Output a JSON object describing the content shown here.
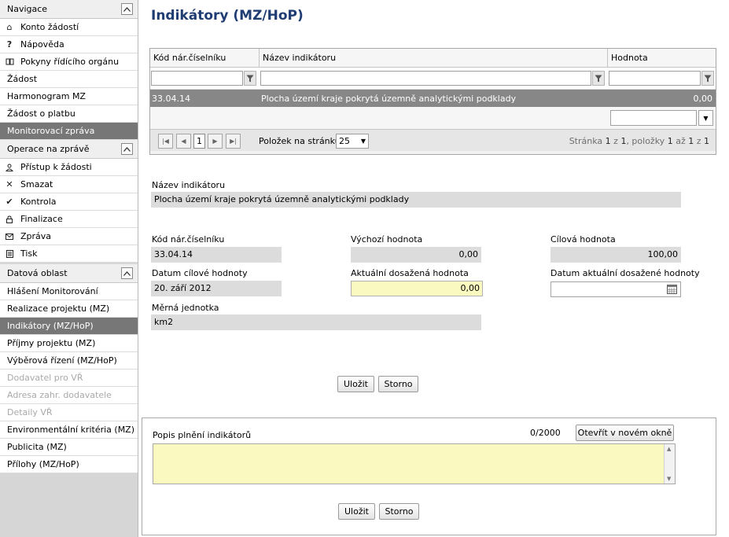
{
  "sidebar": {
    "nav_header": "Navigace",
    "nav_items": [
      {
        "label": "Konto žádostí",
        "icon": "home-icon"
      },
      {
        "label": "Nápověda",
        "icon": "question-icon"
      },
      {
        "label": "Pokyny řídícího orgánu",
        "icon": "book-icon"
      }
    ],
    "plain_items": [
      "Žádost",
      "Harmonogram MZ",
      "Žádost o platbu"
    ],
    "monitor_active": "Monitorovací zpráva",
    "ops_header": "Operace na zprávě",
    "ops_items": [
      {
        "label": "Přístup k žádosti",
        "icon": "user-icon"
      },
      {
        "label": "Smazat",
        "icon": "delete-icon"
      },
      {
        "label": "Kontrola",
        "icon": "check-icon"
      },
      {
        "label": "Finalizace",
        "icon": "lock-icon"
      },
      {
        "label": "Zpráva",
        "icon": "envelope-icon"
      },
      {
        "label": "Tisk",
        "icon": "print-icon"
      }
    ],
    "data_header": "Datová oblast",
    "data_items": [
      {
        "label": "Hlášení Monitorování",
        "state": "normal"
      },
      {
        "label": "Realizace projektu (MZ)",
        "state": "normal"
      },
      {
        "label": "Indikátory (MZ/HoP)",
        "state": "active"
      },
      {
        "label": "Příjmy projektu (MZ)",
        "state": "normal"
      },
      {
        "label": "Výběrová řízení (MZ/HoP)",
        "state": "normal"
      },
      {
        "label": "Dodavatel pro VŘ",
        "state": "disabled"
      },
      {
        "label": "Adresa zahr. dodavatele",
        "state": "disabled"
      },
      {
        "label": "Detaily VŘ",
        "state": "disabled"
      },
      {
        "label": "Environmentální kritéria (MZ)",
        "state": "normal"
      },
      {
        "label": "Publicita (MZ)",
        "state": "normal"
      },
      {
        "label": "Přílohy (MZ/HoP)",
        "state": "normal"
      }
    ]
  },
  "page": {
    "title": "Indikátory (MZ/HoP)"
  },
  "grid": {
    "columns": [
      "Kód nár.číselníku",
      "Název indikátoru",
      "Hodnota"
    ],
    "rows": [
      {
        "code": "33.04.14",
        "name": "Plocha území kraje pokrytá územně analytickými podklady",
        "value": "0,00"
      }
    ],
    "pager": {
      "page": "1",
      "page_size_label": "Položek na stránku",
      "page_size": "25",
      "info_prefix": "Stránka",
      "page_current": "1",
      "info_of": "z",
      "page_total": "1",
      "info_items": ", položky",
      "item_from": "1",
      "info_to": "až",
      "item_to": "1",
      "info_of2": "z",
      "item_total": "1"
    }
  },
  "form": {
    "name_label": "Název indikátoru",
    "name_value": "Plocha území kraje pokrytá územně analytickými podklady",
    "code_label": "Kód nár.číselníku",
    "code_value": "33.04.14",
    "start_label": "Výchozí hodnota",
    "start_value": "0,00",
    "target_label": "Cílová hodnota",
    "target_value": "100,00",
    "target_date_label": "Datum cílové hodnoty",
    "target_date_value": "20. září 2012",
    "actual_label": "Aktuální dosažená hodnota",
    "actual_value": "0,00",
    "actual_date_label": "Datum aktuální dosažené hodnoty",
    "actual_date_value": "",
    "unit_label": "Měrná jednotka",
    "unit_value": "km2",
    "save": "Uložit",
    "cancel": "Storno"
  },
  "description": {
    "label": "Popis plnění indikátorů",
    "counter": "0/2000",
    "open_new_window": "Otevřít v novém okně",
    "value": "",
    "save": "Uložit",
    "cancel": "Storno"
  }
}
